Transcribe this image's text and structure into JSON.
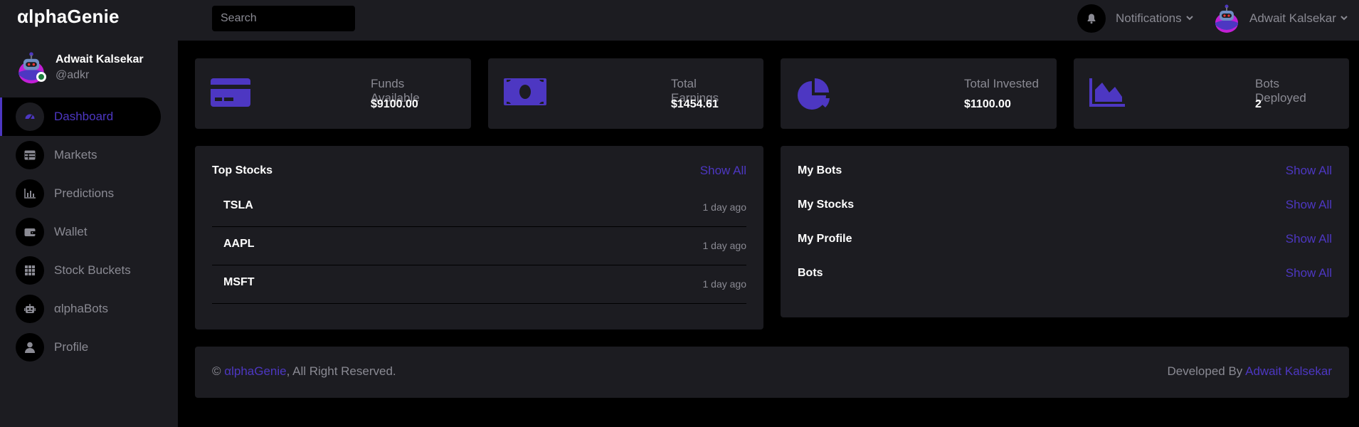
{
  "header": {
    "logo": "αlphaGenie",
    "search_placeholder": "Search",
    "notifications_label": "Notifications",
    "user_name": "Adwait Kalsekar"
  },
  "sidebar": {
    "user_name": "Adwait Kalsekar",
    "user_handle": "@adkr",
    "items": [
      {
        "label": "Dashboard",
        "icon": "speedometer-icon"
      },
      {
        "label": "Markets",
        "icon": "table-icon"
      },
      {
        "label": "Predictions",
        "icon": "bar-chart-icon"
      },
      {
        "label": "Wallet",
        "icon": "wallet-icon"
      },
      {
        "label": "Stock Buckets",
        "icon": "grid-icon"
      },
      {
        "label": "αlphaBots",
        "icon": "robot-icon"
      },
      {
        "label": "Profile",
        "icon": "user-icon"
      }
    ]
  },
  "stats": [
    {
      "label": "Funds Available",
      "value": "$9100.00",
      "icon": "credit-card-icon"
    },
    {
      "label": "Total Earnings",
      "value": "$1454.61",
      "icon": "money-bill-icon"
    },
    {
      "label": "Total Invested",
      "value": "$1100.00",
      "icon": "pie-chart-icon"
    },
    {
      "label": "Bots Deployed",
      "value": "2",
      "icon": "area-chart-icon"
    }
  ],
  "top_stocks": {
    "title": "Top Stocks",
    "show_all": "Show All",
    "rows": [
      {
        "symbol": "TSLA",
        "time": "1 day ago"
      },
      {
        "symbol": "AAPL",
        "time": "1 day ago"
      },
      {
        "symbol": "MSFT",
        "time": "1 day ago"
      }
    ]
  },
  "links_panel": {
    "rows": [
      {
        "label": "My Bots",
        "action": "Show All"
      },
      {
        "label": "My Stocks",
        "action": "Show All"
      },
      {
        "label": "My Profile",
        "action": "Show All"
      },
      {
        "label": "Bots",
        "action": "Show All"
      }
    ]
  },
  "footer": {
    "copyright_symbol": "©",
    "brand": "αlphaGenie",
    "rights": ", All Right Reserved.",
    "developed_by": "Developed By",
    "developer": "Adwait Kalsekar"
  },
  "colors": {
    "accent": "#4d37c2",
    "card_bg": "#1c1c21",
    "page_bg": "#000000",
    "muted_text": "#8a8a93"
  }
}
